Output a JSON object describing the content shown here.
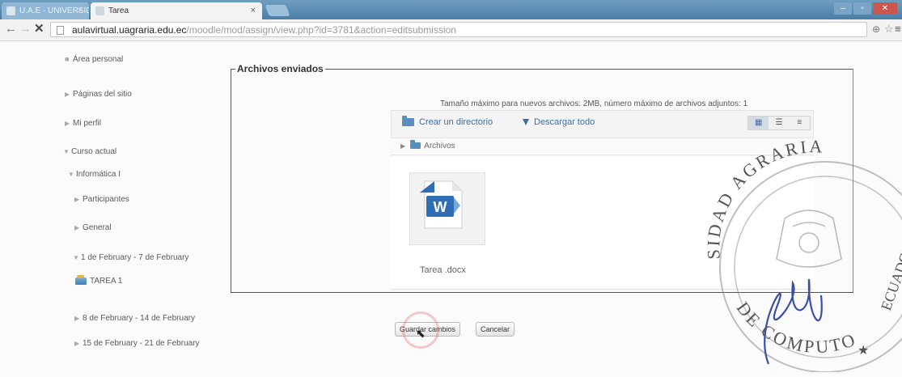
{
  "browser": {
    "tabs": [
      {
        "label": "U.A.E - UNIVERSIDAD A",
        "close": "×",
        "active": false
      },
      {
        "label": "Tarea",
        "close": "×",
        "active": true
      }
    ],
    "url_host": "aulavirtual.uagraria.edu.ec",
    "url_path": "/moodle/mod/assign/view.php?id=3781&action=editsubmission"
  },
  "sidebar": {
    "items": [
      {
        "label": "Área personal"
      },
      {
        "label": "Páginas del sitio"
      },
      {
        "label": "Mi perfil"
      },
      {
        "label": "Curso actual"
      },
      {
        "label": "Informática I"
      },
      {
        "label": "Participantes"
      },
      {
        "label": "General"
      },
      {
        "label": "1 de February - 7 de February"
      },
      {
        "label": "TAREA 1"
      },
      {
        "label": "8 de February - 14 de February"
      },
      {
        "label": "15 de February - 21 de February"
      }
    ]
  },
  "form": {
    "legend": "Archivos enviados",
    "max_info": "Tamaño máximo para nuevos archivos: 2MB, número máximo de archivos adjuntos: 1",
    "mkdir_label": "Crear un directorio",
    "download_label": "Descargar todo",
    "path_label": "Archivos",
    "file_name": "Tarea .docx",
    "save_label": "Guardar cambios",
    "cancel_label": "Cancelar"
  },
  "seal": {
    "text_top": "SIDAD AGRARIA",
    "text_bottom": "DE COMPUTO",
    "text_side": "ECUADOR",
    "star": "★"
  },
  "colors": {
    "link": "#3a6ea5",
    "seal_ink": "#3a4fa8"
  }
}
